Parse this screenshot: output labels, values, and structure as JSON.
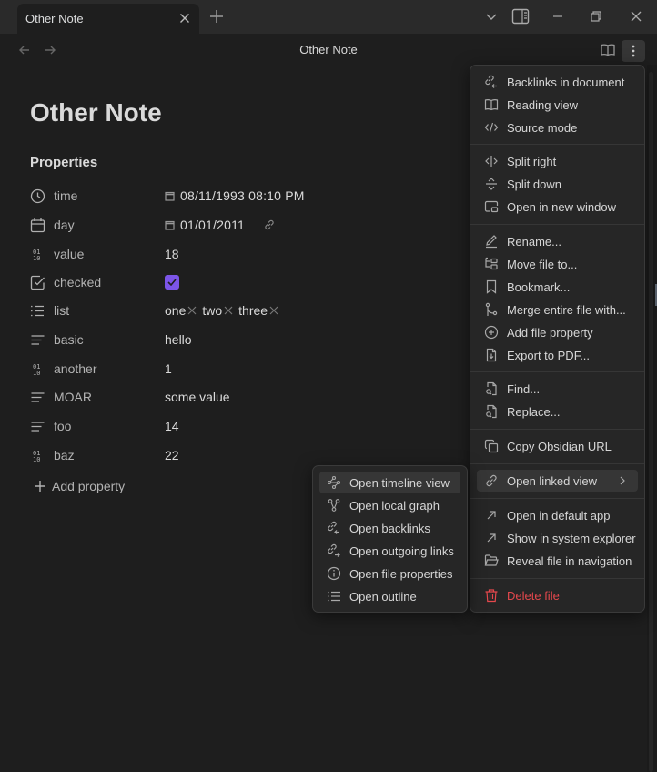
{
  "window": {
    "tab_title": "Other Note",
    "colors": {
      "accent": "#7c55e8",
      "danger": "#e5484d",
      "background": "#1e1e1e",
      "titlebar": "#2a2a2a"
    }
  },
  "navbar": {
    "title": "Other Note"
  },
  "note": {
    "title": "Other Note",
    "properties_heading": "Properties",
    "properties": [
      {
        "icon": "clock-icon",
        "key": "time",
        "value": "08/11/1993 08:10 PM",
        "type": "datetime"
      },
      {
        "icon": "calendar-icon",
        "key": "day",
        "value": "01/01/2011",
        "type": "date"
      },
      {
        "icon": "number-icon",
        "key": "value",
        "value": "18",
        "type": "number"
      },
      {
        "icon": "checkbox-icon",
        "key": "checked",
        "value": "true",
        "type": "checkbox"
      },
      {
        "icon": "list-icon",
        "key": "list",
        "values": [
          "one",
          "two",
          "three"
        ],
        "type": "list"
      },
      {
        "icon": "text-icon",
        "key": "basic",
        "value": "hello",
        "type": "text"
      },
      {
        "icon": "number-icon",
        "key": "another",
        "value": "1",
        "type": "number"
      },
      {
        "icon": "text-icon",
        "key": "MOAR",
        "value": "some value",
        "type": "text"
      },
      {
        "icon": "text-icon",
        "key": "foo",
        "value": "14",
        "type": "text"
      },
      {
        "icon": "number-icon",
        "key": "baz",
        "value": "22",
        "type": "number"
      }
    ],
    "add_property_label": "Add property"
  },
  "main_menu": {
    "items": [
      {
        "label": "Backlinks in document",
        "icon": "backlinks-icon"
      },
      {
        "label": "Reading view",
        "icon": "book-open-icon"
      },
      {
        "label": "Source mode",
        "icon": "code-icon"
      },
      {
        "label": "Split right",
        "icon": "split-right-icon"
      },
      {
        "label": "Split down",
        "icon": "split-down-icon"
      },
      {
        "label": "Open in new window",
        "icon": "new-window-icon"
      },
      {
        "label": "Rename...",
        "icon": "pencil-icon"
      },
      {
        "label": "Move file to...",
        "icon": "folder-tree-icon"
      },
      {
        "label": "Bookmark...",
        "icon": "bookmark-icon"
      },
      {
        "label": "Merge entire file with...",
        "icon": "git-merge-icon"
      },
      {
        "label": "Add file property",
        "icon": "plus-circle-icon"
      },
      {
        "label": "Export to PDF...",
        "icon": "file-download-icon"
      },
      {
        "label": "Find...",
        "icon": "file-search-icon"
      },
      {
        "label": "Replace...",
        "icon": "file-search-icon"
      },
      {
        "label": "Copy Obsidian URL",
        "icon": "copy-icon"
      },
      {
        "label": "Open linked view",
        "icon": "link-icon"
      },
      {
        "label": "Open in default app",
        "icon": "arrow-up-right-icon"
      },
      {
        "label": "Show in system explorer",
        "icon": "arrow-up-right-icon"
      },
      {
        "label": "Reveal file in navigation",
        "icon": "folder-open-icon"
      },
      {
        "label": "Delete file",
        "icon": "trash-icon"
      }
    ]
  },
  "sub_menu": {
    "items": [
      {
        "label": "Open timeline view",
        "icon": "timeline-icon"
      },
      {
        "label": "Open local graph",
        "icon": "graph-icon"
      },
      {
        "label": "Open backlinks",
        "icon": "backlinks-icon"
      },
      {
        "label": "Open outgoing links",
        "icon": "outgoing-links-icon"
      },
      {
        "label": "Open file properties",
        "icon": "info-icon"
      },
      {
        "label": "Open outline",
        "icon": "list-icon"
      }
    ]
  }
}
